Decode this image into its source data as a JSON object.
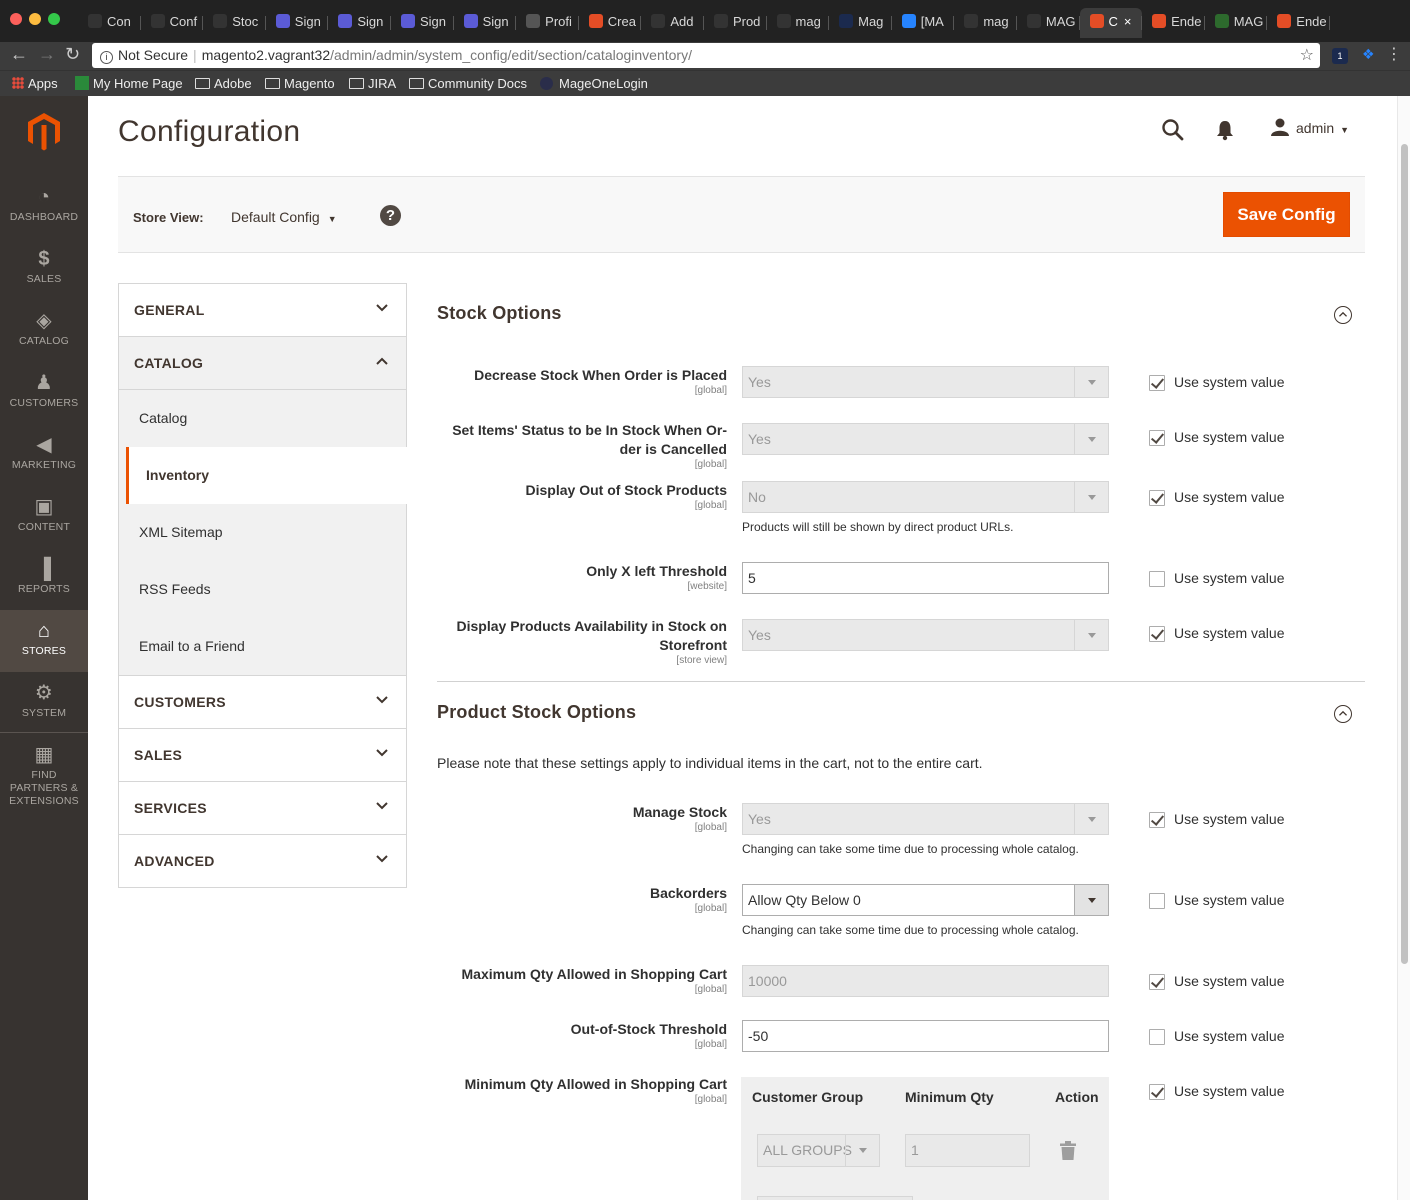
{
  "browser": {
    "tabs": [
      {
        "label": "Con",
        "color": "#333333"
      },
      {
        "label": "Conf",
        "color": "#333333"
      },
      {
        "label": "Stoc",
        "color": "#333333"
      },
      {
        "label": "Sign",
        "color": "#5b5bd6"
      },
      {
        "label": "Sign",
        "color": "#5b5bd6"
      },
      {
        "label": "Sign",
        "color": "#5b5bd6"
      },
      {
        "label": "Sign",
        "color": "#5b5bd6"
      },
      {
        "label": "Profi",
        "color": "#555555"
      },
      {
        "label": "Crea",
        "color": "#e44d26"
      },
      {
        "label": "Add",
        "color": "#333333"
      },
      {
        "label": "Prod",
        "color": "#333333"
      },
      {
        "label": "mag",
        "color": "#333333"
      },
      {
        "label": "Mag",
        "color": "#1b2a4e"
      },
      {
        "label": "[MA",
        "color": "#2684ff"
      },
      {
        "label": "mag",
        "color": "#333333"
      },
      {
        "label": "MAG",
        "color": "#333333"
      },
      {
        "label": "C",
        "color": "#e44d26"
      },
      {
        "label": "Ende",
        "color": "#e44d26"
      },
      {
        "label": "MAG",
        "color": "#2d6a2d"
      },
      {
        "label": "Ende",
        "color": "#e44d26"
      }
    ],
    "active_tab_index": 16,
    "url_security": "Not Secure",
    "url_host": "magento2.vagrant32",
    "url_path": "/admin/admin/system_config/edit/section/cataloginventory/",
    "bookmarks": {
      "apps": "Apps",
      "home": "My Home Page",
      "adobe": "Adobe",
      "magento": "Magento",
      "jira": "JIRA",
      "community": "Community Docs",
      "mageone": "MageOneLogin"
    }
  },
  "menu": {
    "items": [
      {
        "label": "DASHBOARD",
        "icon": "dashboard-icon"
      },
      {
        "label": "SALES",
        "icon": "dollar-icon"
      },
      {
        "label": "CATALOG",
        "icon": "cube-icon"
      },
      {
        "label": "CUSTOMERS",
        "icon": "person-icon"
      },
      {
        "label": "MARKETING",
        "icon": "megaphone-icon"
      },
      {
        "label": "CONTENT",
        "icon": "layout-icon"
      },
      {
        "label": "REPORTS",
        "icon": "bar-chart-icon"
      },
      {
        "label": "STORES",
        "icon": "store-icon"
      },
      {
        "label": "SYSTEM",
        "icon": "gear-icon"
      },
      {
        "label": "FIND PARTNERS & EXTENSIONS",
        "icon": "blocks-icon"
      }
    ],
    "active": "STORES"
  },
  "header": {
    "title": "Configuration",
    "user": "admin"
  },
  "store_bar": {
    "label": "Store View:",
    "value": "Default Config",
    "help": "?",
    "save": "Save Config"
  },
  "config_nav": {
    "general": "GENERAL",
    "catalog": "CATALOG",
    "catalog_items": [
      "Catalog",
      "Inventory",
      "XML Sitemap",
      "RSS Feeds",
      "Email to a Friend"
    ],
    "customers": "CUSTOMERS",
    "sales": "SALES",
    "services": "SERVICES",
    "advanced": "ADVANCED"
  },
  "stock_options": {
    "title": "Stock Options",
    "decrease": {
      "label": "Decrease Stock When Order is Placed",
      "scope": "[global]",
      "value": "Yes",
      "use_system": "Use system value"
    },
    "set_status": {
      "label_1": "Set Items' Status to be In Stock When Or-",
      "label_2": "der is Cancelled",
      "scope": "[global]",
      "value": "Yes",
      "use_system": "Use system value"
    },
    "display_oos": {
      "label": "Display Out of Stock Products",
      "scope": "[global]",
      "value": "No",
      "note": "Products will still be shown by direct product URLs.",
      "use_system": "Use system value"
    },
    "threshold": {
      "label": "Only X left Threshold",
      "scope": "[website]",
      "value": "5",
      "use_system": "Use system value"
    },
    "availability": {
      "label_1": "Display Products Availability in Stock on",
      "label_2": "Storefront",
      "scope": "[store view]",
      "value": "Yes",
      "use_system": "Use system value"
    }
  },
  "product_stock": {
    "title": "Product Stock Options",
    "intro": "Please note that these settings apply to individual items in the cart, not to the entire cart.",
    "manage": {
      "label": "Manage Stock",
      "scope": "[global]",
      "value": "Yes",
      "note": "Changing can take some time due to processing whole catalog.",
      "use_system": "Use system value"
    },
    "backorders": {
      "label": "Backorders",
      "scope": "[global]",
      "value": "Allow Qty Below 0",
      "note": "Changing can take some time due to processing whole catalog.",
      "use_system": "Use system value"
    },
    "max_qty": {
      "label": "Maximum Qty Allowed in Shopping Cart",
      "scope": "[global]",
      "value": "10000",
      "use_system": "Use system value"
    },
    "oos_threshold": {
      "label": "Out-of-Stock Threshold",
      "scope": "[global]",
      "value": "-50",
      "use_system": "Use system value"
    },
    "min_qty": {
      "label": "Minimum Qty Allowed in Shopping Cart",
      "scope": "[global]",
      "use_system": "Use system value",
      "col_group": "Customer Group",
      "col_qty": "Minimum Qty",
      "col_action": "Action",
      "row_group": "ALL GROUPS",
      "row_qty": "1"
    }
  },
  "colors": {
    "accent": "#eb5202",
    "menu_bg": "#373330",
    "menu_active": "#514943"
  }
}
